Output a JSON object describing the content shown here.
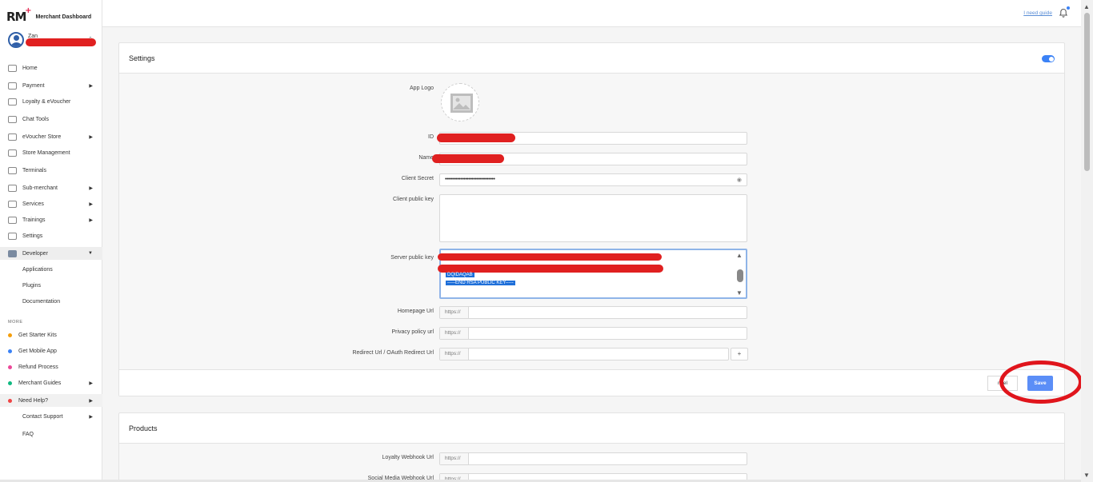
{
  "brand": {
    "logo": "RM",
    "title": "Merchant Dashboard"
  },
  "profile": {
    "name": "Zan"
  },
  "sidebar": {
    "items": [
      {
        "label": "Home",
        "icon": "chart-icon",
        "arrow": ""
      },
      {
        "label": "Payment",
        "icon": "wallet-icon",
        "arrow": "▶"
      },
      {
        "label": "Loyalty & eVoucher",
        "icon": "tag-icon",
        "arrow": ""
      },
      {
        "label": "Chat Tools",
        "icon": "share-icon",
        "arrow": ""
      },
      {
        "label": "eVoucher Store",
        "icon": "grid-icon",
        "arrow": "▶"
      },
      {
        "label": "Store Management",
        "icon": "store-icon",
        "arrow": ""
      },
      {
        "label": "Terminals",
        "icon": "qr-icon",
        "arrow": ""
      },
      {
        "label": "Sub-merchant",
        "icon": "branch-icon",
        "arrow": "▶"
      },
      {
        "label": "Services",
        "icon": "rocket-icon",
        "arrow": "▶"
      },
      {
        "label": "Trainings",
        "icon": "slides-icon",
        "arrow": "▶"
      },
      {
        "label": "Settings",
        "icon": "gear-icon",
        "arrow": ""
      },
      {
        "label": "Developer",
        "icon": "code-icon",
        "arrow": "▼"
      }
    ],
    "developer_sub": [
      "Applications",
      "Plugins",
      "Documentation"
    ],
    "more_label": "MORE",
    "more_items": [
      {
        "label": "Get Starter Kits",
        "color": "#f59e0b",
        "arrow": ""
      },
      {
        "label": "Get Mobile App",
        "color": "#3b82f6",
        "arrow": ""
      },
      {
        "label": "Refund Process",
        "color": "#ec4899",
        "arrow": ""
      },
      {
        "label": "Merchant Guides",
        "color": "#10b981",
        "arrow": "▶"
      },
      {
        "label": "Need Help?",
        "color": "#ef4444",
        "arrow": "▶"
      }
    ],
    "help_sub": [
      {
        "label": "Contact Support",
        "arrow": "▶"
      },
      {
        "label": "FAQ",
        "arrow": ""
      }
    ]
  },
  "topbar": {
    "guide_link": "I need guide"
  },
  "settings": {
    "title": "Settings",
    "fields": {
      "app_logo": "App Logo",
      "id": "ID",
      "name": "Name",
      "client_secret": "Client Secret",
      "client_secret_value": "••••••••••••••••••••••••••••••••",
      "client_public_key": "Client public key",
      "server_public_key": "Server public key",
      "server_key_lines": [
        "DQIDAQAB",
        "-----END RSA PUBLIC KEY-----"
      ],
      "homepage_url": "Homepage Url",
      "privacy_policy_url": "Privacy policy url",
      "redirect_url": "Redirect Url / OAuth Redirect Url",
      "url_prefix": "https://",
      "add_symbol": "+"
    },
    "footer": {
      "cancel": "ncel",
      "save": "Save"
    }
  },
  "products": {
    "title": "Products",
    "fields": {
      "loyalty_webhook": "Loyalty Webhook Url",
      "social_webhook": "Social Media Webhook Url",
      "url_prefix": "https://"
    }
  },
  "colors": {
    "accent": "#5b8ef7",
    "annotation": "#e0151c",
    "redaction": "#e02020"
  }
}
